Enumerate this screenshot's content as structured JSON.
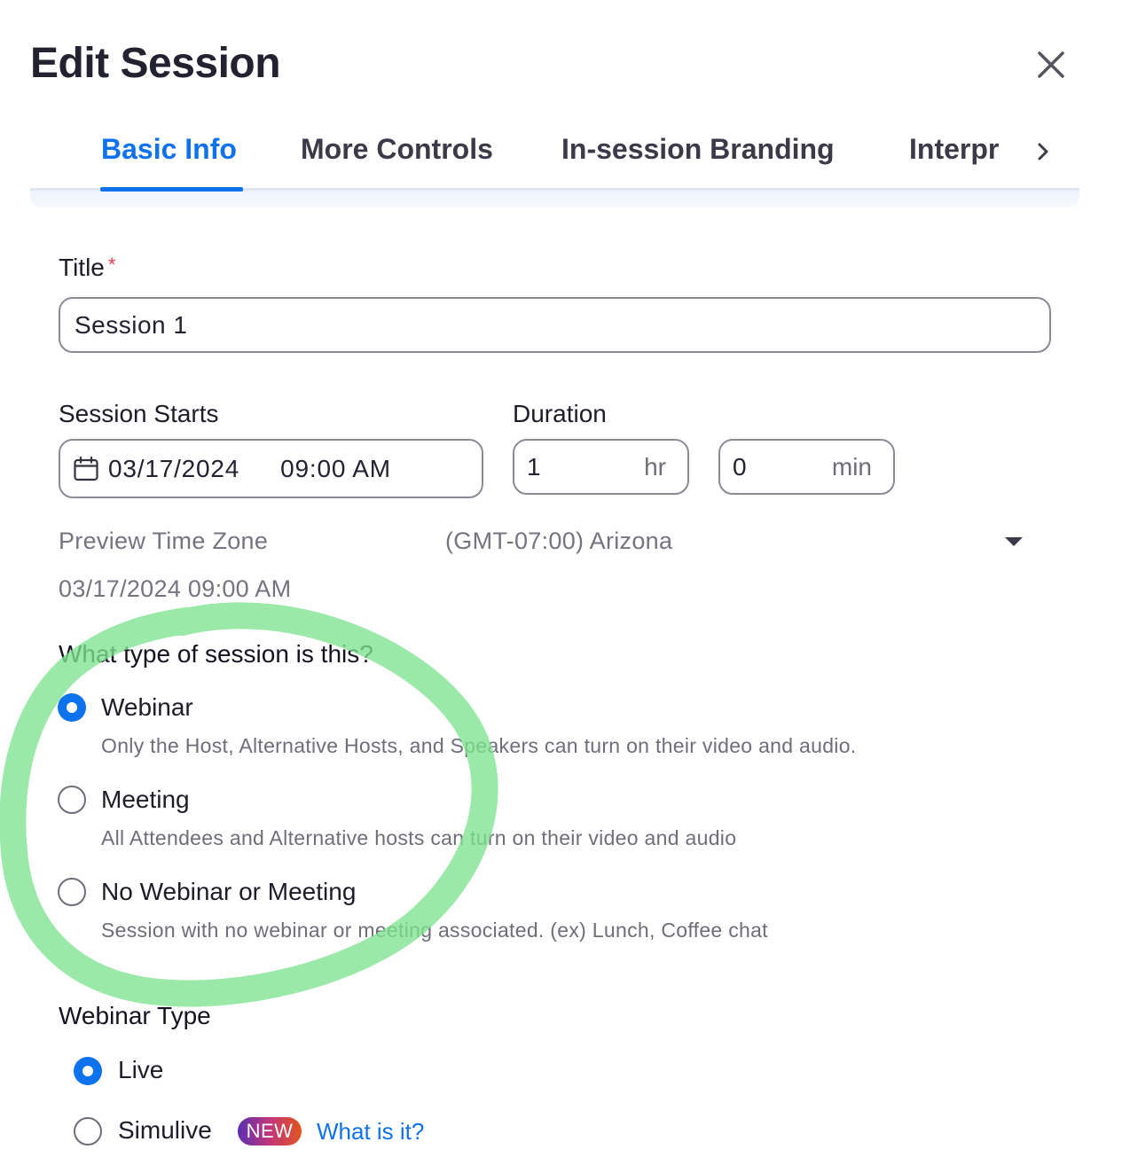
{
  "dialog": {
    "title": "Edit Session",
    "close_icon": "close-icon"
  },
  "tabs": [
    {
      "label": "Basic Info",
      "active": true
    },
    {
      "label": "More Controls",
      "active": false
    },
    {
      "label": "In-session Branding",
      "active": false
    },
    {
      "label": "Interpr",
      "active": false
    }
  ],
  "tabs_next_icon": "chevron-right-icon",
  "form": {
    "title_label": "Title",
    "title_required_mark": "*",
    "title_value": "Session 1",
    "starts_label": "Session Starts",
    "start_date": "03/17/2024",
    "start_time": "09:00 AM",
    "calendar_icon": "calendar-icon",
    "duration_label": "Duration",
    "duration_hours": "1",
    "duration_hours_unit": "hr",
    "duration_minutes": "0",
    "duration_minutes_unit": "min",
    "preview_tz_label": "Preview Time Zone",
    "preview_tz_value": "(GMT-07:00) Arizona",
    "preview_datetime": "03/17/2024 09:00 AM"
  },
  "session_type": {
    "question": "What type of session is this?",
    "options": [
      {
        "label": "Webinar",
        "description": "Only the Host, Alternative Hosts, and Speakers can turn on their video and audio.",
        "selected": true
      },
      {
        "label": "Meeting",
        "description": "All Attendees and Alternative hosts can turn on their video and audio",
        "selected": false
      },
      {
        "label": "No Webinar or Meeting",
        "description": "Session with no webinar or meeting associated. (ex) Lunch, Coffee chat",
        "selected": false
      }
    ]
  },
  "webinar_type": {
    "label": "Webinar Type",
    "options": [
      {
        "label": "Live",
        "selected": true
      },
      {
        "label": "Simulive",
        "selected": false
      }
    ],
    "new_badge": "NEW",
    "help_link": "What is it?"
  },
  "colors": {
    "accent": "#0e72ed",
    "required": "#e8364a",
    "highlight_marker": "#7ee38f"
  }
}
